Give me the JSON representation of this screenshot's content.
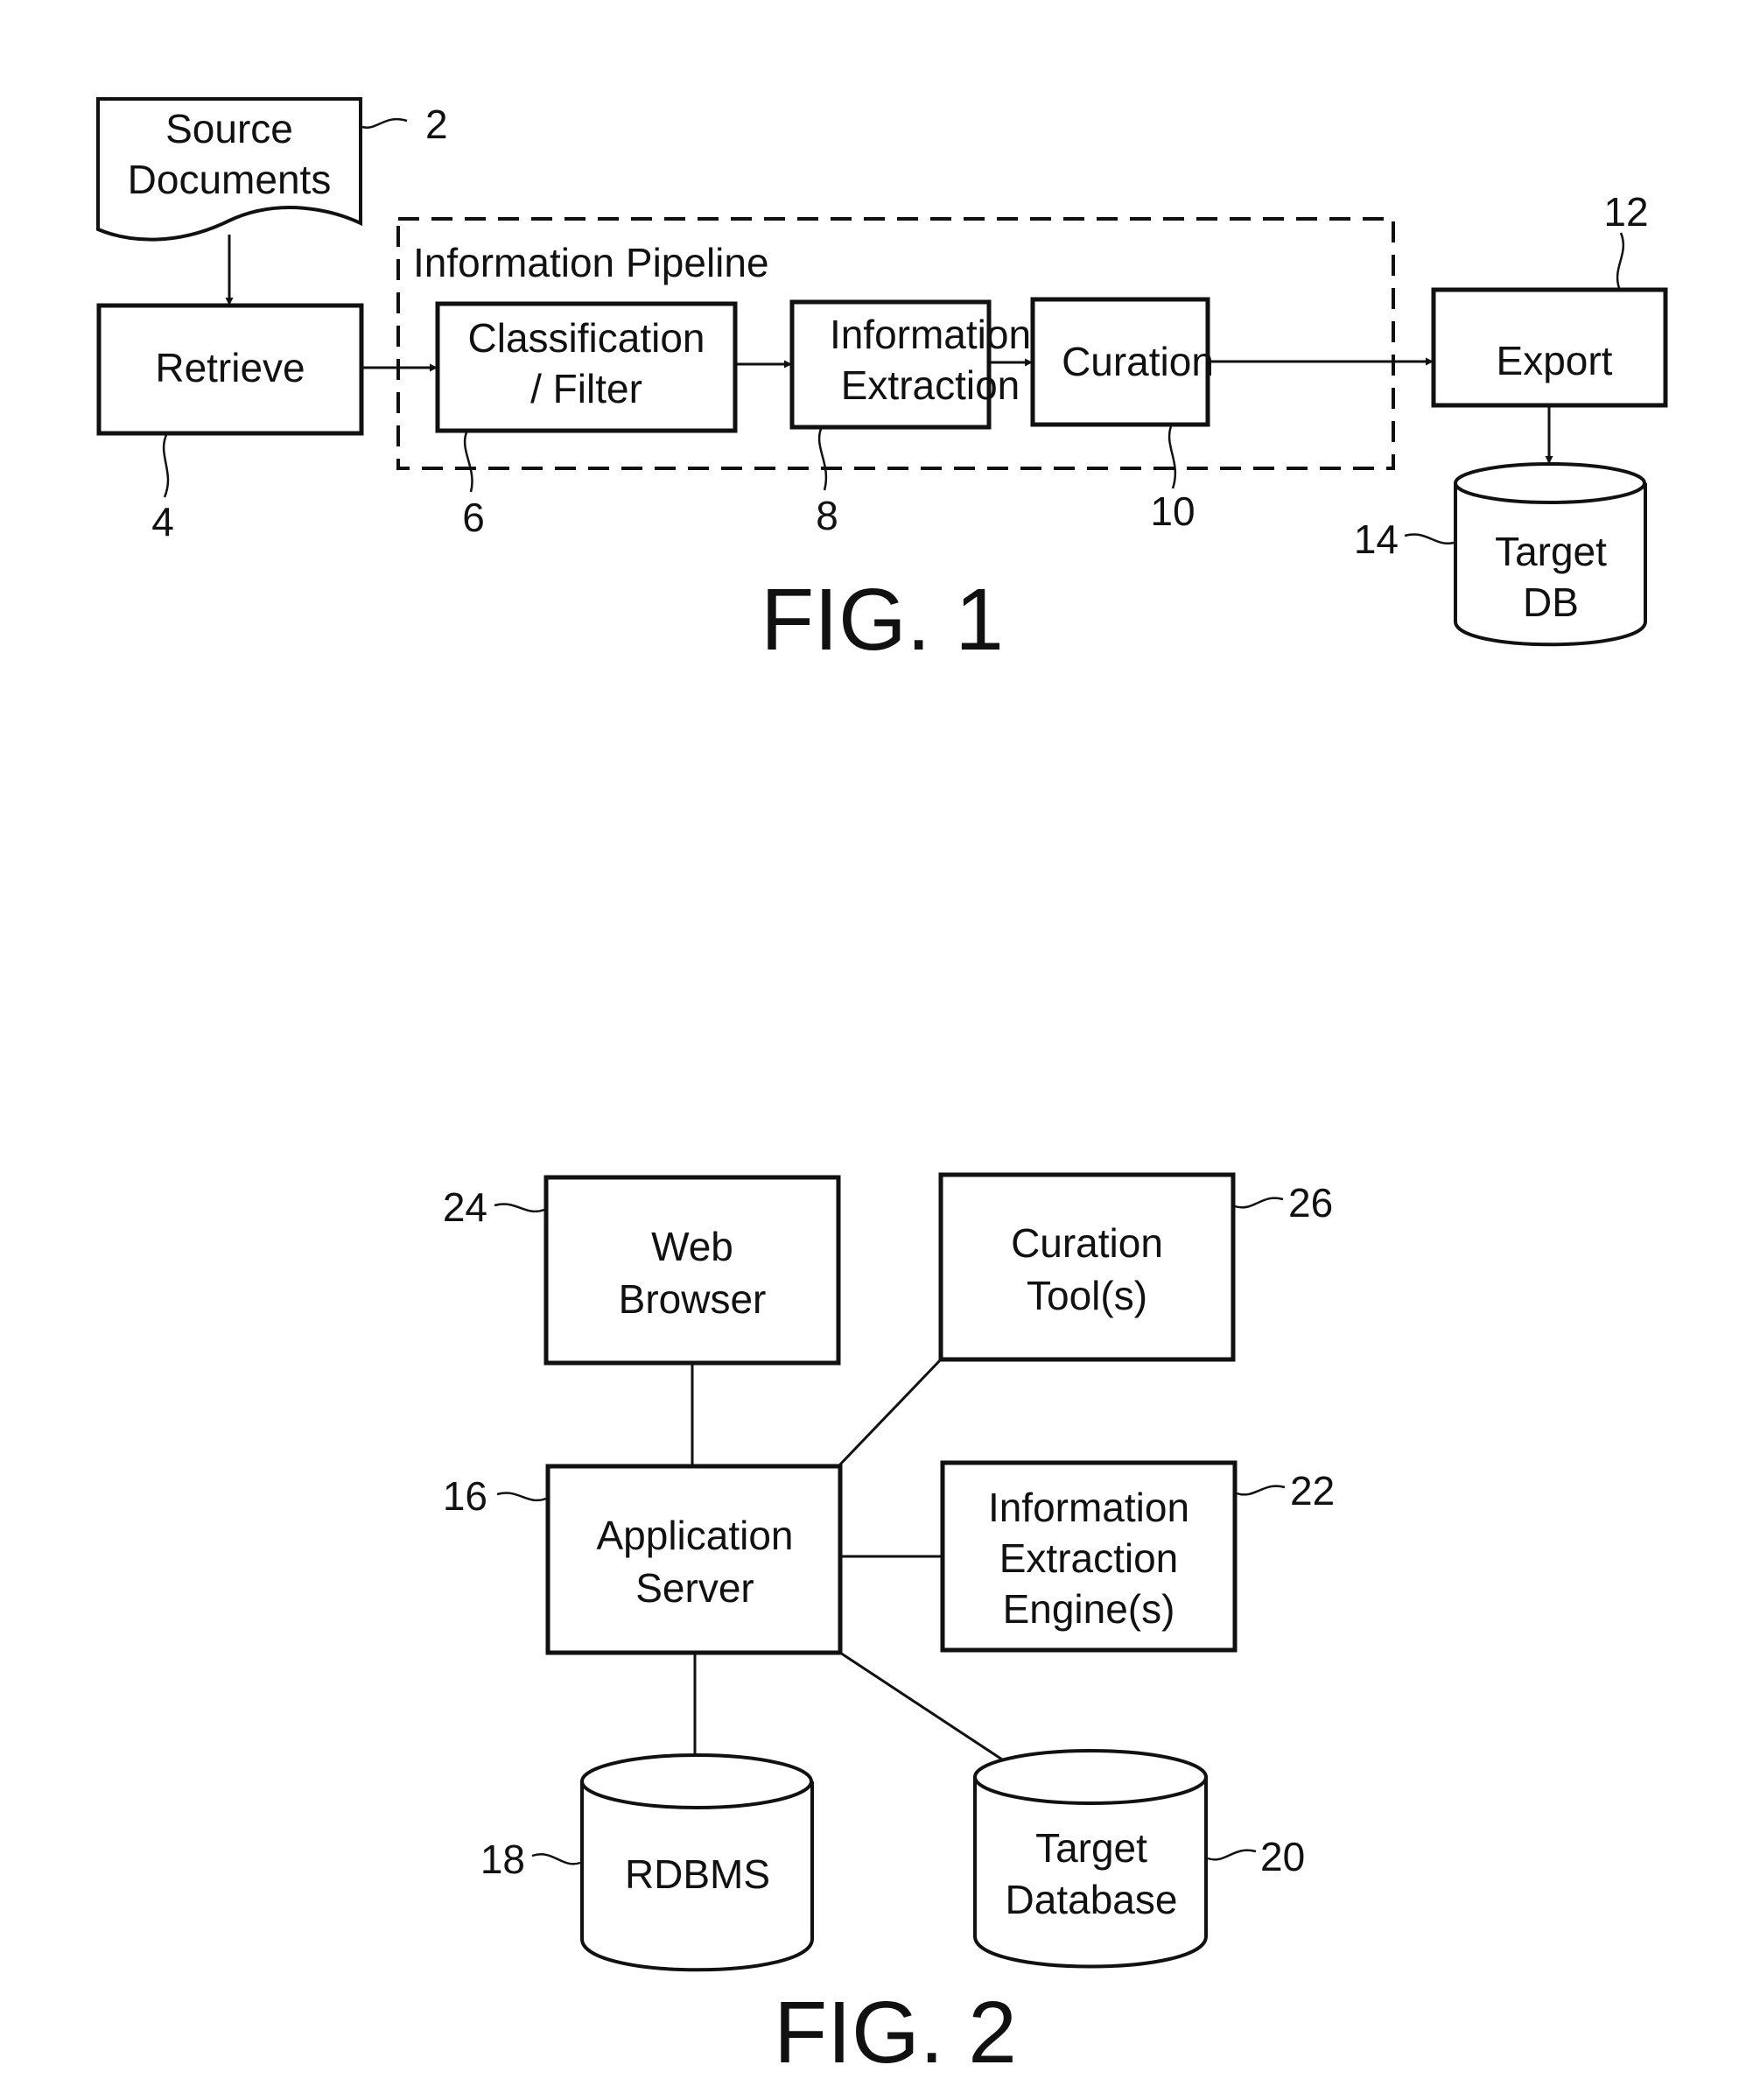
{
  "figures": [
    {
      "id": "fig1",
      "caption": "FIG. 1",
      "group": {
        "label": "Information Pipeline"
      },
      "nodes": [
        {
          "key": "source",
          "shape": "document",
          "lines": [
            "Source",
            "Documents"
          ],
          "ref": "2"
        },
        {
          "key": "retrieve",
          "shape": "box",
          "lines": [
            "Retrieve"
          ],
          "ref": "4"
        },
        {
          "key": "classify",
          "shape": "box",
          "lines": [
            "Classification",
            "/ Filter"
          ],
          "ref": "6"
        },
        {
          "key": "extract",
          "shape": "box",
          "lines": [
            "Information",
            "Extraction"
          ],
          "ref": "8"
        },
        {
          "key": "curation",
          "shape": "box",
          "lines": [
            "Curation"
          ],
          "ref": "10"
        },
        {
          "key": "export",
          "shape": "box",
          "lines": [
            "Export"
          ],
          "ref": "12"
        },
        {
          "key": "targetdb",
          "shape": "cylinder",
          "lines": [
            "Target",
            "DB"
          ],
          "ref": "14"
        }
      ],
      "edges": [
        {
          "from": "source",
          "to": "retrieve",
          "directed": true
        },
        {
          "from": "retrieve",
          "to": "classify",
          "directed": true
        },
        {
          "from": "classify",
          "to": "extract",
          "directed": true
        },
        {
          "from": "extract",
          "to": "curation",
          "directed": true
        },
        {
          "from": "curation",
          "to": "export",
          "directed": true
        },
        {
          "from": "export",
          "to": "targetdb",
          "directed": true
        }
      ]
    },
    {
      "id": "fig2",
      "caption": "FIG. 2",
      "nodes": [
        {
          "key": "browser",
          "shape": "box",
          "lines": [
            "Web",
            "Browser"
          ],
          "ref": "24"
        },
        {
          "key": "curtools",
          "shape": "box",
          "lines": [
            "Curation",
            "Tool(s)"
          ],
          "ref": "26"
        },
        {
          "key": "appserver",
          "shape": "box",
          "lines": [
            "Application",
            "Server"
          ],
          "ref": "16"
        },
        {
          "key": "ieengine",
          "shape": "box",
          "lines": [
            "Information",
            "Extraction",
            "Engine(s)"
          ],
          "ref": "22"
        },
        {
          "key": "rdbms",
          "shape": "cylinder",
          "lines": [
            "RDBMS"
          ],
          "ref": "18"
        },
        {
          "key": "targetdatabase",
          "shape": "cylinder",
          "lines": [
            "Target",
            "Database"
          ],
          "ref": "20"
        }
      ],
      "edges": [
        {
          "from": "browser",
          "to": "appserver",
          "directed": false
        },
        {
          "from": "curtools",
          "to": "appserver",
          "directed": false
        },
        {
          "from": "ieengine",
          "to": "appserver",
          "directed": false
        },
        {
          "from": "appserver",
          "to": "rdbms",
          "directed": false
        },
        {
          "from": "appserver",
          "to": "targetdatabase",
          "directed": false
        }
      ]
    }
  ]
}
